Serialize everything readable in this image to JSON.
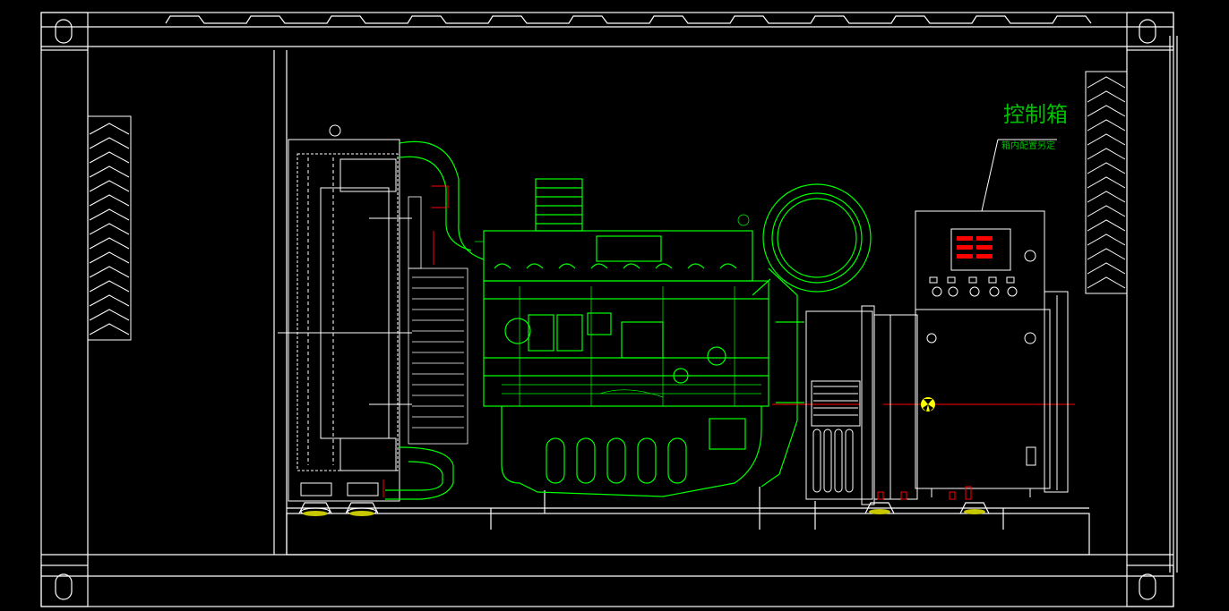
{
  "drawing": {
    "title_label": "控制箱",
    "subtitle_label": "箱内配置另定",
    "background": "#000000",
    "colors": {
      "frame": "#ffffff",
      "engine": "#00ff00",
      "accent_red": "#ff0000",
      "gauge_yellow": "#ffff00",
      "label_green": "#00c000"
    },
    "panel_indicators": 6
  }
}
